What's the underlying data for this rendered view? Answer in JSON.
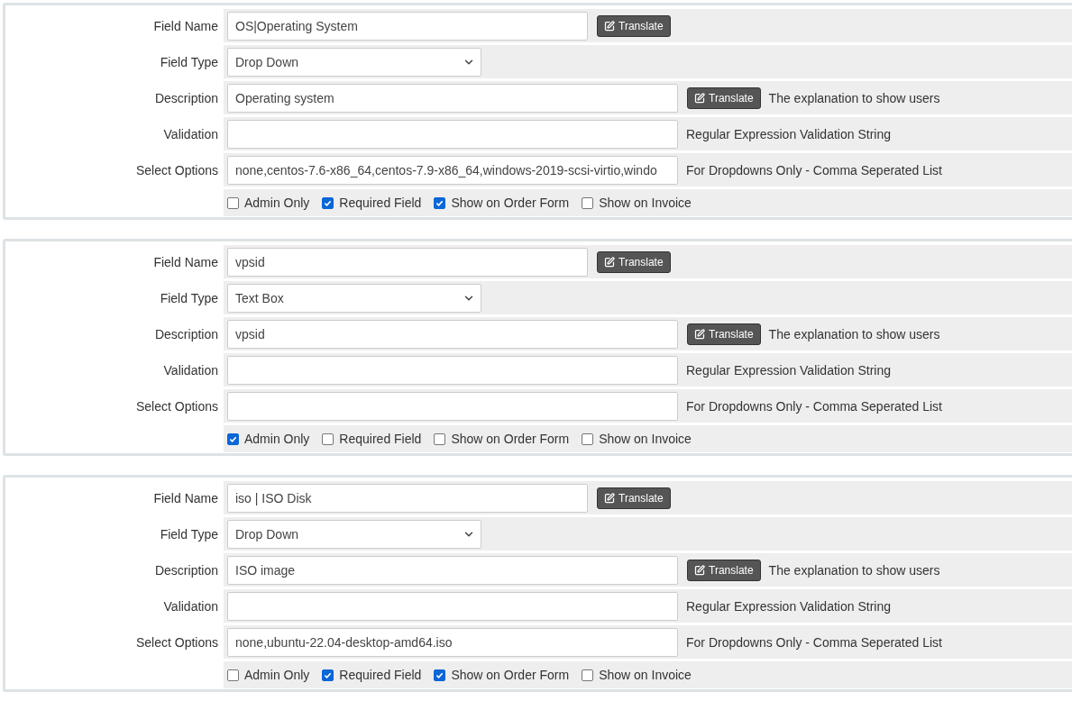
{
  "custom_fields": [
    {
      "rows": [
        {
          "kind": "name",
          "label": "Field Name",
          "value": "OS|Operating System",
          "button": "Translate"
        },
        {
          "kind": "select",
          "label": "Field Type",
          "value": "Drop Down"
        },
        {
          "kind": "long",
          "label": "Description",
          "value": "Operating system",
          "button": "Translate",
          "hint": "The explanation to show users"
        },
        {
          "kind": "long",
          "label": "Validation",
          "hint": "Regular Expression Validation String"
        },
        {
          "kind": "long",
          "label": "Select Options",
          "value": "none,centos-7.6-x86_64,centos-7.9-x86_64,windows-2019-scsi-virtio,windo",
          "hint": "For Dropdowns Only - Comma Seperated List"
        }
      ],
      "checkboxes": [
        {
          "label": "Admin Only",
          "checked": false
        },
        {
          "label": "Required Field",
          "checked": true
        },
        {
          "label": "Show on Order Form",
          "checked": true
        },
        {
          "label": "Show on Invoice",
          "checked": false
        }
      ]
    },
    {
      "rows": [
        {
          "kind": "name",
          "label": "Field Name",
          "value": "vpsid",
          "button": "Translate"
        },
        {
          "kind": "select",
          "label": "Field Type",
          "value": "Text Box"
        },
        {
          "kind": "long",
          "label": "Description",
          "value": "vpsid",
          "button": "Translate",
          "hint": "The explanation to show users"
        },
        {
          "kind": "long",
          "label": "Validation",
          "hint": "Regular Expression Validation String"
        },
        {
          "kind": "long",
          "label": "Select Options",
          "hint": "For Dropdowns Only - Comma Seperated List"
        }
      ],
      "checkboxes": [
        {
          "label": "Admin Only",
          "checked": true
        },
        {
          "label": "Required Field",
          "checked": false
        },
        {
          "label": "Show on Order Form",
          "checked": false
        },
        {
          "label": "Show on Invoice",
          "checked": false
        }
      ]
    },
    {
      "rows": [
        {
          "kind": "name",
          "label": "Field Name",
          "value": "iso | ISO Disk",
          "button": "Translate"
        },
        {
          "kind": "select",
          "label": "Field Type",
          "value": "Drop Down"
        },
        {
          "kind": "long",
          "label": "Description",
          "value": "ISO image",
          "button": "Translate",
          "hint": "The explanation to show users"
        },
        {
          "kind": "long",
          "label": "Validation",
          "hint": "Regular Expression Validation String"
        },
        {
          "kind": "long",
          "label": "Select Options",
          "value": "none,ubuntu-22.04-desktop-amd64.iso",
          "hint": "For Dropdowns Only - Comma Seperated List"
        }
      ],
      "checkboxes": [
        {
          "label": "Admin Only",
          "checked": false
        },
        {
          "label": "Required Field",
          "checked": true
        },
        {
          "label": "Show on Order Form",
          "checked": true
        },
        {
          "label": "Show on Invoice",
          "checked": false
        }
      ]
    }
  ]
}
